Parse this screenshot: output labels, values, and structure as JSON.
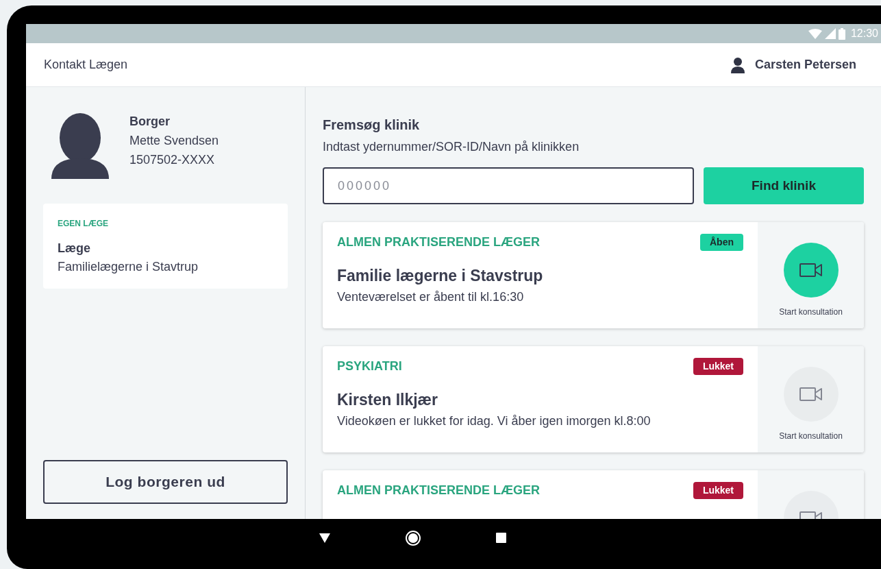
{
  "status_bar": {
    "time": "12:30"
  },
  "header": {
    "title": "Kontakt Lægen",
    "user": "Carsten Petersen"
  },
  "patient": {
    "role": "Borger",
    "name": "Mette Svendsen",
    "cpr": "1507502-XXXX"
  },
  "own_doctor": {
    "heading": "EGEN LÆGE",
    "label": "Læge",
    "clinic": "Familielægerne i Stavtrup"
  },
  "logout_button": "Log borgeren ud",
  "search": {
    "title": "Fremsøg klinik",
    "hint": "Indtast ydernummer/SOR-ID/Navn på klinikken",
    "placeholder": "000000",
    "button": "Find klinik"
  },
  "clinics": [
    {
      "category": "ALMEN PRAKTISERENDE LÆGER",
      "status": "Åben",
      "kind": "open",
      "name": "Familie lægerne i Stavstrup",
      "note": "Venteværelset er åbent til kl.16:30",
      "action": "Start konsultation"
    },
    {
      "category": "PSYKIATRI",
      "status": "Lukket",
      "kind": "closed",
      "name": "Kirsten Ilkjær",
      "note": "Videokøen er lukket for idag. Vi åber igen imorgen kl.8:00",
      "action": "Start konsultation"
    },
    {
      "category": "ALMEN PRAKTISERENDE LÆGER",
      "status": "Lukket",
      "kind": "closed"
    }
  ]
}
